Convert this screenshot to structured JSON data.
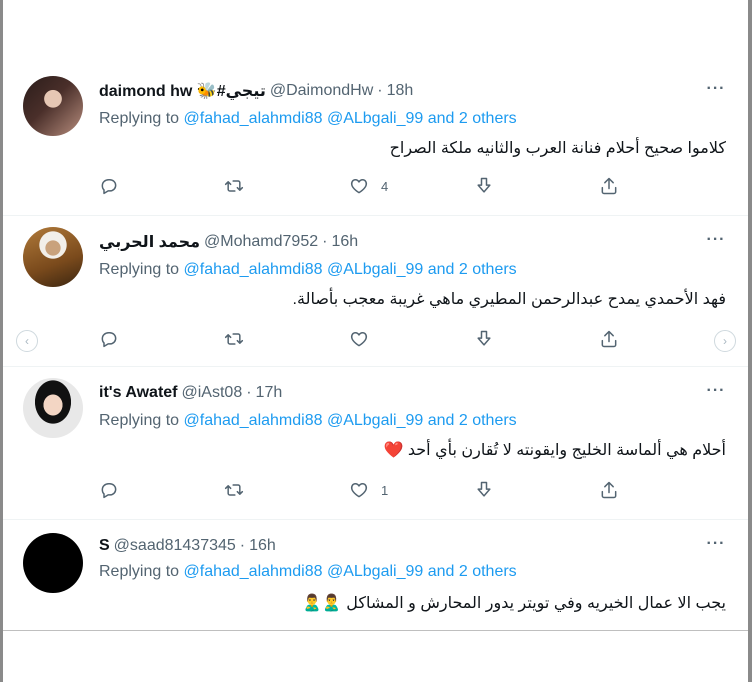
{
  "replying_label": "Replying to",
  "replying_mentions": "@fahad_alahmdi88 @ALbgali_99 and 2 others",
  "tweets": [
    {
      "name": "daimond hw 🐝#تيجي",
      "handle": "@DaimondHw",
      "separator": "·",
      "time": "18h",
      "text": "كلاموا صحيح أحلام فنانة العرب والثانيه ملكة الصراح",
      "reply_count": "",
      "retweet_count": "",
      "like_count": "4"
    },
    {
      "name": "محمد الحربي",
      "handle": "@Mohamd7952",
      "separator": "·",
      "time": "16h",
      "text": "فهد الأحمدي يمدح عبدالرحمن المطيري ماهي غريبة معجب بأصالة.",
      "reply_count": "",
      "retweet_count": "",
      "like_count": ""
    },
    {
      "name": "it's Awatef",
      "handle": "@iAst08",
      "separator": "·",
      "time": "17h",
      "text": "أحلام هي ألماسة الخليج وايقونته لا تُقارن بأي أحد ❤️",
      "reply_count": "",
      "retweet_count": "",
      "like_count": "1"
    },
    {
      "name": "S",
      "handle": "@saad81437345",
      "separator": "·",
      "time": "16h",
      "text": "يجب الا عمال الخيريه وفي تويتر يدور المحارش و المشاكل 🙎‍♂️🙎‍♂️"
    }
  ],
  "more_label": "···",
  "carousel": {
    "prev": "‹",
    "next": "›"
  },
  "colors": {
    "accent": "#1d9bf0",
    "secondary": "#536471",
    "text": "#0f1419"
  },
  "icons": [
    "reply-icon",
    "retweet-icon",
    "like-icon",
    "dislike-icon",
    "share-icon"
  ]
}
